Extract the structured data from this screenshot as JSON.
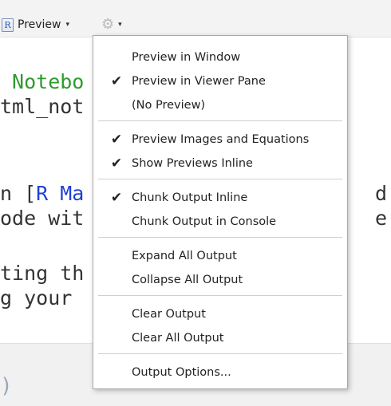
{
  "toolbar": {
    "doc_icon": "rmarkdown-doc-icon",
    "doc_icon_letter": "R",
    "preview_label": "Preview",
    "caret": "▾",
    "gear_glyph": "⚙"
  },
  "editor": {
    "lines": [
      " Notebo",
      "tml_not",
      "n [",
      "R Ma",
      "ode wit",
      "ting th",
      "g your",
      "d",
      "e"
    ]
  },
  "console": {
    "paren": ")"
  },
  "menu": {
    "check_glyph": "✔",
    "groups": [
      [
        {
          "label": "Preview in Window",
          "checked": false
        },
        {
          "label": "Preview in Viewer Pane",
          "checked": true
        },
        {
          "label": "(No Preview)",
          "checked": false
        }
      ],
      [
        {
          "label": "Preview Images and Equations",
          "checked": true
        },
        {
          "label": "Show Previews Inline",
          "checked": true
        }
      ],
      [
        {
          "label": "Chunk Output Inline",
          "checked": true
        },
        {
          "label": "Chunk Output in Console",
          "checked": false
        }
      ],
      [
        {
          "label": "Expand All Output",
          "checked": false
        },
        {
          "label": "Collapse All Output",
          "checked": false
        }
      ],
      [
        {
          "label": "Clear Output",
          "checked": false
        },
        {
          "label": "Clear All Output",
          "checked": false
        }
      ],
      [
        {
          "label": "Output Options...",
          "checked": false
        }
      ]
    ]
  }
}
